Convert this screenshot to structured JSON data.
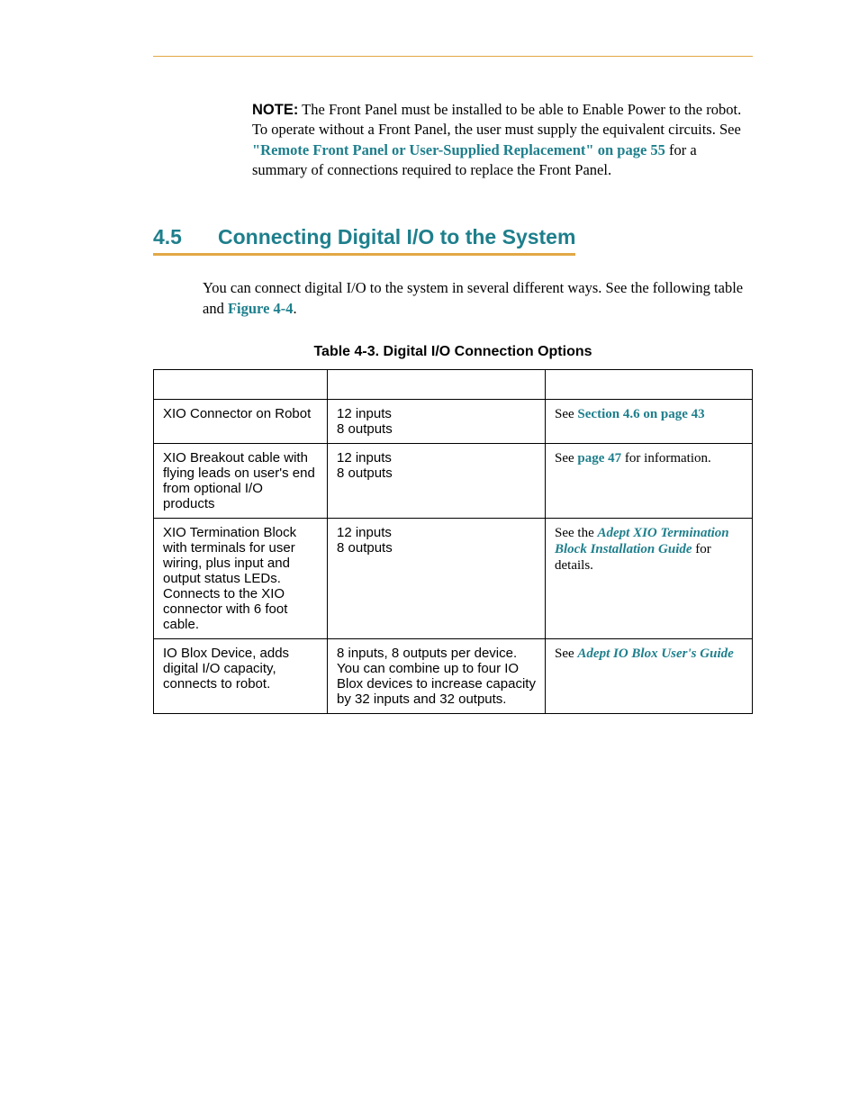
{
  "note": {
    "label": "NOTE:",
    "pre": " The Front Panel must be installed to be able to Enable Power to the robot. To operate without a Front Panel, the user must supply the equivalent circuits. See ",
    "link": "\"Remote Front Panel or User-Supplied Replacement\" on page 55",
    "post": " for a summary of connections required to replace the Front Panel."
  },
  "section": {
    "num": "4.5",
    "title": "Connecting Digital I/O to the System"
  },
  "intro": {
    "pre": "You can connect digital I/O to the system in several different ways. See the following table and ",
    "link": "Figure 4-4",
    "post": "."
  },
  "table": {
    "caption": "Table 4-3. Digital I/O Connection Options",
    "rows": [
      {
        "c1": "XIO Connector on Robot",
        "c2": "12 inputs\n8 outputs",
        "c3_pre": "See ",
        "c3_link": "Section 4.6 on page 43",
        "c3_post": ""
      },
      {
        "c1": "XIO Breakout cable with flying leads on user's end from optional I/O products",
        "c2": "12 inputs\n8 outputs",
        "c3_pre": "See ",
        "c3_link": "page 47",
        "c3_post": " for information."
      },
      {
        "c1": "XIO Termination Block with terminals for user wiring, plus input and output status LEDs. Connects to the XIO connector with 6 foot cable.",
        "c2": "12 inputs\n8 outputs",
        "c3_pre": "See the ",
        "c3_link": "Adept XIO Termination Block Installation Guide",
        "c3_post": " for details."
      },
      {
        "c1": "IO Blox Device, adds digital I/O capacity, connects to robot.",
        "c2": "8 inputs, 8 outputs per device. You can combine up to four IO Blox devices to increase capacity by 32 inputs and 32 outputs.",
        "c3_pre": "See ",
        "c3_link": "Adept IO Blox User's Guide",
        "c3_post": ""
      }
    ]
  }
}
